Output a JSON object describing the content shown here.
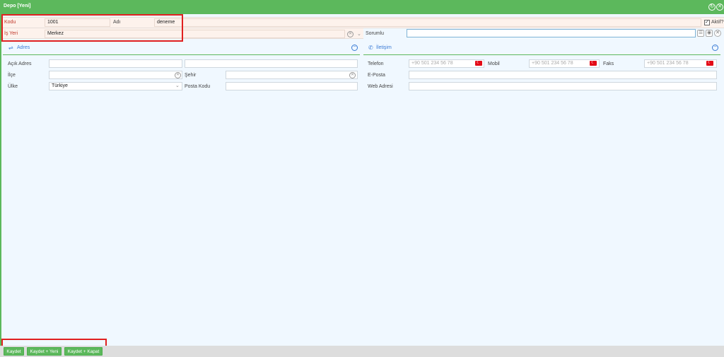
{
  "window": {
    "title": "Depo [Yeni]",
    "refresh_icon": "refresh-icon",
    "close_icon": "close-icon"
  },
  "header": {
    "kodu_label": "Kodu",
    "kodu_value": "1001",
    "adi_label": "Adı",
    "adi_value": "deneme",
    "aktif_label": "Aktif?",
    "aktif_checked": true,
    "isyeri_label": "İş Yeri",
    "isyeri_value": "Merkez",
    "sorumlu_label": "Sorumlu",
    "sorumlu_value": ""
  },
  "adres": {
    "title": "Adres",
    "acik_adres_label": "Açık Adres",
    "ilce_label": "İlçe",
    "sehir_label": "Şehir",
    "ulke_label": "Ülke",
    "ulke_value": "Türkiye",
    "posta_kodu_label": "Posta Kodu"
  },
  "iletisim": {
    "title": "İletişim",
    "telefon_label": "Telefon",
    "telefon_placeholder": "+90 501 234 56 78",
    "mobil_label": "Mobil",
    "mobil_placeholder": "+90 501 234 56 78",
    "faks_label": "Faks",
    "faks_placeholder": "+90 501 234 56 78",
    "eposta_label": "E-Posta",
    "web_label": "Web Adresi"
  },
  "footer": {
    "save_label": "Kaydet",
    "save_new_label": "Kaydet + Yeni",
    "save_close_label": "Kaydet + Kapat"
  },
  "colors": {
    "accent": "#5cb85c",
    "highlight": "#e02020",
    "link": "#3a7bd5",
    "required_bg": "#fdf2ec"
  }
}
